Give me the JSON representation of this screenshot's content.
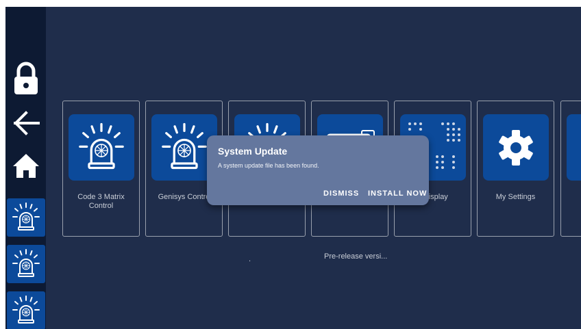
{
  "sidebar": {
    "icons": [
      "lock-icon",
      "back-arrow-icon",
      "home-icon"
    ],
    "tiles": [
      "beacon-icon",
      "beacon-icon",
      "beacon-icon"
    ]
  },
  "apps": [
    {
      "label": "Code 3 Matrix\nControl",
      "icon": "beacon-icon"
    },
    {
      "label": "Genisys Contro",
      "icon": "beacon-icon"
    },
    {
      "label": "",
      "icon": "beacon-icon"
    },
    {
      "label": "",
      "icon": "monitor-icon"
    },
    {
      "label": "x Display",
      "icon": "dot-matrix-icon"
    },
    {
      "label": "My Settings",
      "icon": "gear-icon"
    }
  ],
  "footer": {
    "dot": ".",
    "version": "Pre-release versi..."
  },
  "dialog": {
    "title": "System Update",
    "message": "A system update file has been found.",
    "dismiss_label": "DISMISS",
    "install_label": "INSTALL NOW"
  },
  "colors": {
    "background": "#1f2d4b",
    "sidebar": "#0d1a33",
    "tile": "#0c4a9a",
    "dialog": "#64779e"
  }
}
